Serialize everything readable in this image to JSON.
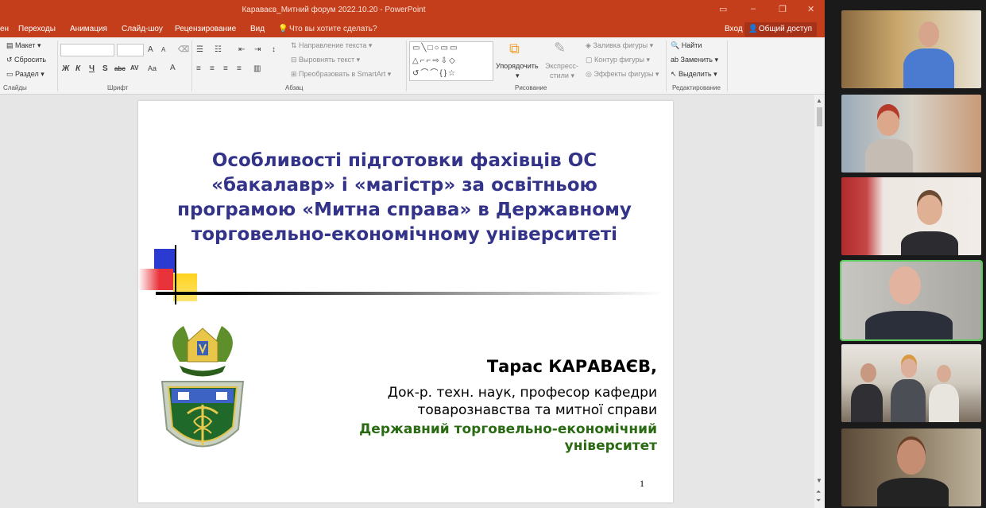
{
  "window": {
    "title": "Караваєв_Митний форум 2022.10.20  -  PowerPoint",
    "minimize_icon": "minimize-icon",
    "maximize_icon": "restore-icon",
    "close_icon": "close-icon"
  },
  "tabs": {
    "items": [
      "ен",
      "Переходы",
      "Анимация",
      "Слайд-шоу",
      "Рецензирование",
      "Вид"
    ],
    "tell_me": "Что вы хотите сделать?",
    "signin": "Вход",
    "share": "Общий доступ"
  },
  "ribbon": {
    "slides": {
      "layout": "Макет",
      "reset": "Сбросить",
      "section": "Раздел",
      "label": "Слайды"
    },
    "font": {
      "label": "Шрифт"
    },
    "paragraph": {
      "label": "Абзац",
      "text_direction": "Направление текста",
      "align_text": "Выровнять текст",
      "smartart": "Преобразовать в SmartArt"
    },
    "drawing": {
      "label": "Рисование",
      "arrange": "Упорядочить",
      "quick_styles_1": "Экспресс-",
      "quick_styles_2": "стили",
      "shape_fill": "Заливка фигуры",
      "shape_outline": "Контур фигуры",
      "shape_effects": "Эффекты фигуры"
    },
    "editing": {
      "label": "Редактирование",
      "find": "Найти",
      "replace": "Заменить",
      "select": "Выделить"
    }
  },
  "slide": {
    "title": "Особливості підготовки фахівців ОС «бакалавр» і «магістр» за освітньою програмою «Митна справа» в Державному торговельно-економічному університеті",
    "author": "Тарас КАРАВАЄВ,",
    "position": "Док-р. техн. наук, професор кафедри товарознавства та митної справи",
    "university": "Державний торговельно-економічний університет",
    "page_number": "1"
  },
  "colors": {
    "ppt_accent": "#c43e1c",
    "title_text": "#333389",
    "university_text": "#2a6a13",
    "active_speaker": "#5ccc5c"
  }
}
